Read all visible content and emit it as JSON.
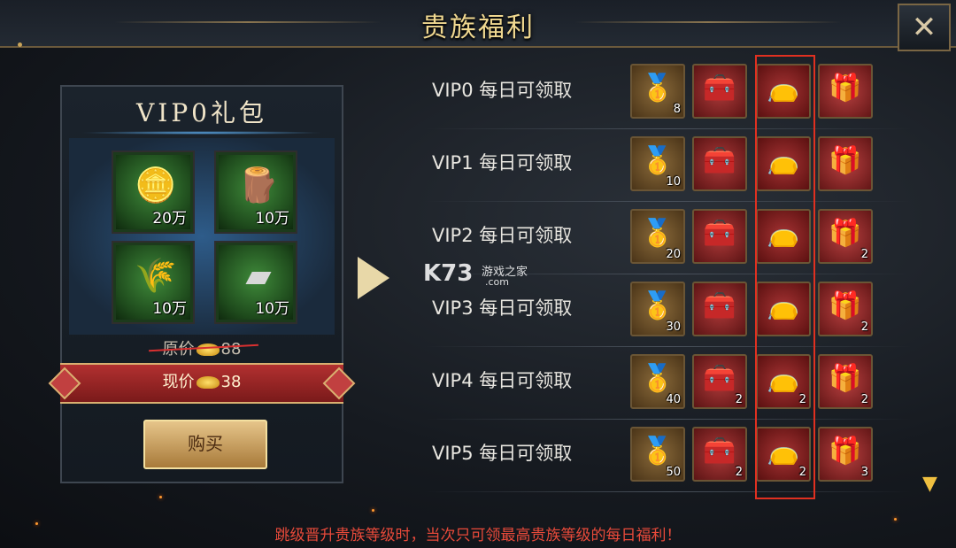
{
  "window": {
    "title": "贵族福利",
    "close_icon": "close-icon"
  },
  "package": {
    "title": "VIP0礼包",
    "items": [
      {
        "icon": "coin-icon",
        "glyph": "🪙",
        "qty": "20万"
      },
      {
        "icon": "wood-icon",
        "glyph": "🪵",
        "qty": "10万"
      },
      {
        "icon": "grain-icon",
        "glyph": "🌾",
        "qty": "10万"
      },
      {
        "icon": "iron-icon",
        "glyph": "▰",
        "qty": "10万"
      }
    ],
    "original_price_label": "原价",
    "original_price": "88",
    "current_price_label": "现价",
    "current_price": "38",
    "buy_label": "购买"
  },
  "vip_rows": [
    {
      "label": "VIP0 每日可领取",
      "ingot": "8",
      "chest": "",
      "bag": "",
      "box": ""
    },
    {
      "label": "VIP1 每日可领取",
      "ingot": "10",
      "chest": "",
      "bag": "",
      "box": ""
    },
    {
      "label": "VIP2 每日可领取",
      "ingot": "20",
      "chest": "",
      "bag": "",
      "box": "2"
    },
    {
      "label": "VIP3 每日可领取",
      "ingot": "30",
      "chest": "",
      "bag": "",
      "box": "2"
    },
    {
      "label": "VIP4 每日可领取",
      "ingot": "40",
      "chest": "2",
      "bag": "2",
      "box": "2"
    },
    {
      "label": "VIP5 每日可领取",
      "ingot": "50",
      "chest": "2",
      "bag": "2",
      "box": "3"
    }
  ],
  "watermark": {
    "main": "K73",
    "sub": "游戏之家",
    "com": ".com"
  },
  "footer_note": "跳级晋升贵族等级时，当次只可领最高贵族等级的每日福利！",
  "colors": {
    "title": "#f0d890",
    "highlight": "#e03020",
    "footer": "#e84a3a"
  }
}
